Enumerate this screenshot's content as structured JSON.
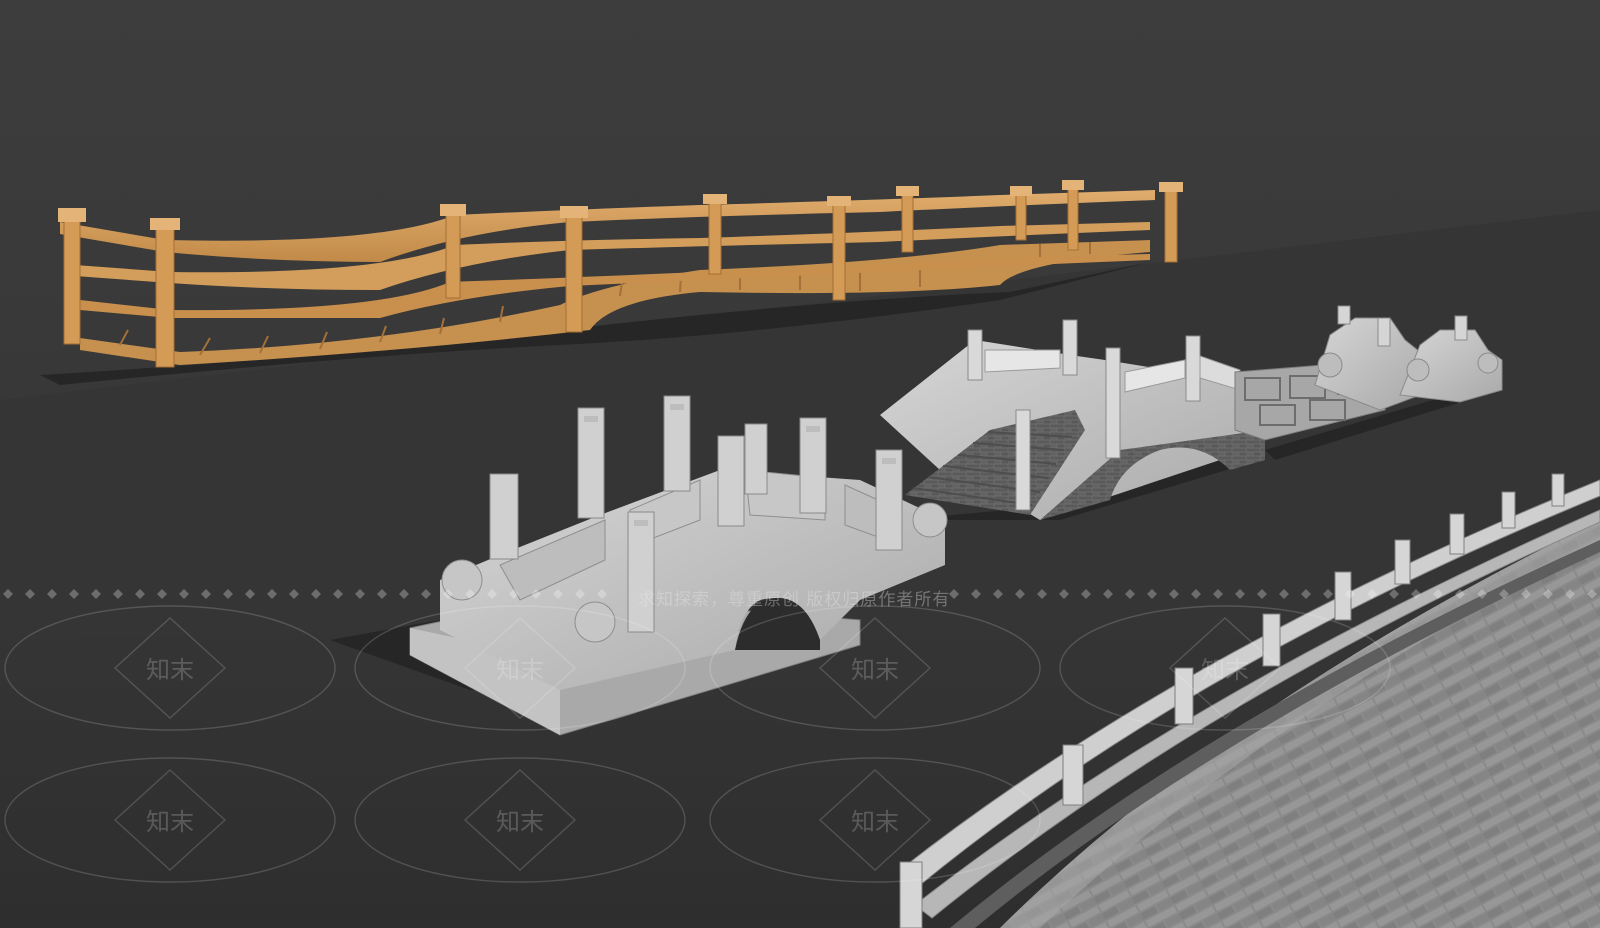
{
  "colors": {
    "background_top": "#3a3a3a",
    "background_bottom": "#2e2e2e",
    "wood": "#d8a262",
    "wood_dark": "#a97439",
    "stone": "#c9c9c9",
    "stone_dark": "#8e8e8e",
    "brick": "#6a6a6a",
    "paving": "#8c8c8c"
  },
  "watermark": {
    "logo_text": "知末",
    "caption": "求知探索，尊重原创 版权归原作者所有"
  },
  "scene_objects": [
    {
      "id": "wooden-curved-bridge",
      "material": "wood"
    },
    {
      "id": "stone-arch-bridge-large",
      "material": "granite"
    },
    {
      "id": "stone-arch-bridge-with-stairs",
      "material": "stone-brick"
    },
    {
      "id": "stone-railing-bridge-small",
      "material": "granite"
    },
    {
      "id": "paved-bridge-with-railing",
      "material": "stone-paving"
    }
  ]
}
